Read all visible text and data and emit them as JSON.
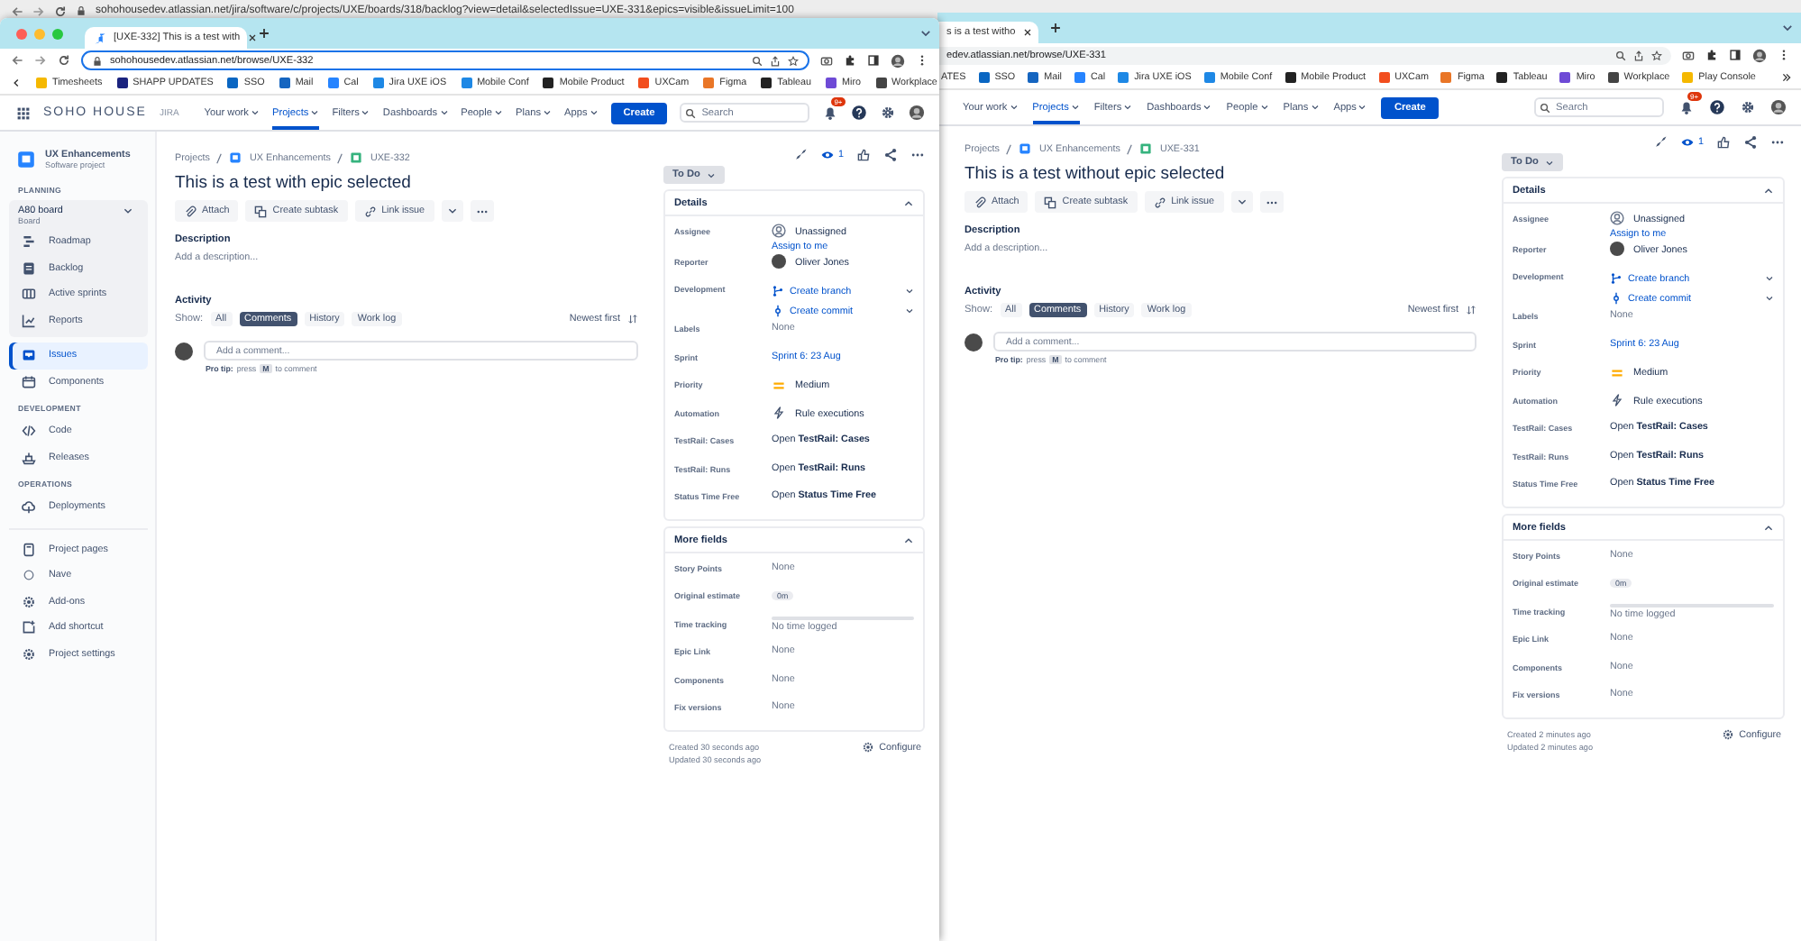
{
  "background_window": {
    "url": "sohohousedev.atlassian.net/jira/software/c/projects/UXE/boards/318/backlog?view=detail&selectedIssue=UXE-331&epics=visible&issueLimit=100"
  },
  "windows": [
    {
      "tab_title": "[UXE-332] This is a test with",
      "url": "sohohousedev.atlassian.net/browse/UXE-332",
      "bookmarks": [
        "Timesheets",
        "SHAPP UPDATES",
        "SSO",
        "Mail",
        "Cal",
        "Jira UXE iOS",
        "Mobile Conf",
        "Mobile Product",
        "UXCam",
        "Figma",
        "Tableau",
        "Miro",
        "Workplace"
      ],
      "nav": {
        "logo": "SOHO HOUSE",
        "product": "JIRA",
        "menu": [
          {
            "label": "Your work",
            "selected": false
          },
          {
            "label": "Projects",
            "selected": true
          },
          {
            "label": "Filters",
            "selected": false
          },
          {
            "label": "Dashboards",
            "selected": false
          },
          {
            "label": "People",
            "selected": false
          },
          {
            "label": "Plans",
            "selected": false
          },
          {
            "label": "Apps",
            "selected": false
          }
        ],
        "create": "Create",
        "search_placeholder": "Search",
        "notifications": "9+"
      },
      "sidebar": {
        "project": {
          "name": "UX Enhancements",
          "type": "Software project"
        },
        "sections": [
          {
            "heading": "PLANNING",
            "board": {
              "name": "A80 board",
              "subtitle": "Board",
              "items": [
                {
                  "label": "Roadmap",
                  "selected": false
                },
                {
                  "label": "Backlog",
                  "selected": false
                },
                {
                  "label": "Active sprints",
                  "selected": false
                },
                {
                  "label": "Reports",
                  "selected": false
                }
              ]
            },
            "items": [
              {
                "label": "Issues",
                "selected": true
              },
              {
                "label": "Components",
                "selected": false
              }
            ]
          },
          {
            "heading": "DEVELOPMENT",
            "items": [
              {
                "label": "Code",
                "selected": false
              },
              {
                "label": "Releases",
                "selected": false
              }
            ]
          },
          {
            "heading": "OPERATIONS",
            "items": [
              {
                "label": "Deployments",
                "selected": false
              }
            ]
          }
        ],
        "footer_items": [
          {
            "label": "Project pages",
            "selected": false
          },
          {
            "label": "Nave",
            "selected": false
          },
          {
            "label": "Add-ons",
            "selected": false
          },
          {
            "label": "Add shortcut",
            "selected": false
          },
          {
            "label": "Project settings",
            "selected": false
          }
        ]
      },
      "issue": {
        "breadcrumbs": [
          "Projects",
          "UX Enhancements",
          "UXE-332"
        ],
        "title": "This is a test with epic selected",
        "actions": [
          "Attach",
          "Create subtask",
          "Link issue"
        ],
        "watchers": "1",
        "description_label": "Description",
        "description_placeholder": "Add a description...",
        "activity_label": "Activity",
        "show_label": "Show:",
        "filters": [
          {
            "label": "All",
            "selected": false
          },
          {
            "label": "Comments",
            "selected": true
          },
          {
            "label": "History",
            "selected": false
          },
          {
            "label": "Work log",
            "selected": false
          }
        ],
        "sort": "Newest first",
        "comment_placeholder": "Add a comment...",
        "pro_tip": {
          "label": "Pro tip:",
          "before": "press",
          "key": "M",
          "after": "to comment"
        },
        "status": "To Do",
        "details_title": "Details",
        "details": [
          {
            "label": "Assignee",
            "kind": "assignee",
            "value": "Unassigned",
            "action": "Assign to me"
          },
          {
            "label": "Reporter",
            "kind": "user",
            "value": "Oliver Jones"
          },
          {
            "label": "Development",
            "kind": "development",
            "links": [
              "Create branch",
              "Create commit"
            ]
          },
          {
            "label": "Labels",
            "kind": "text",
            "value": "None"
          },
          {
            "label": "Sprint",
            "kind": "link",
            "value": "Sprint 6: 23 Aug"
          },
          {
            "label": "Priority",
            "kind": "priority",
            "value": "Medium"
          },
          {
            "label": "Automation",
            "kind": "automation",
            "value": "Rule executions"
          },
          {
            "label": "TestRail: Cases",
            "kind": "open",
            "value": "Open **TestRail: Cases**"
          },
          {
            "label": "TestRail: Runs",
            "kind": "open",
            "value": "Open **TestRail: Runs**"
          },
          {
            "label": "Status Time Free",
            "kind": "open",
            "value": "Open **Status Time Free**"
          }
        ],
        "more_title": "More fields",
        "more_fields": [
          {
            "label": "Story Points",
            "kind": "text",
            "value": "None"
          },
          {
            "label": "Original estimate",
            "kind": "badge",
            "value": "0m"
          },
          {
            "label": "Time tracking",
            "kind": "tracking",
            "value": "No time logged",
            "level": 0
          },
          {
            "label": "Epic Link",
            "kind": "text",
            "value": "None"
          },
          {
            "label": "Components",
            "kind": "text",
            "value": "None"
          },
          {
            "label": "Fix versions",
            "kind": "text",
            "value": "None"
          }
        ],
        "created": "Created 30 seconds ago",
        "updated": "Updated 30 seconds ago",
        "configure": "Configure"
      }
    },
    {
      "tab_title": "s is a test witho",
      "url": "edev.atlassian.net/browse/UXE-331",
      "bookmarks": [
        "ATES",
        "SSO",
        "Mail",
        "Cal",
        "Jira UXE iOS",
        "Mobile Conf",
        "Mobile Product",
        "UXCam",
        "Figma",
        "Tableau",
        "Miro",
        "Workplace",
        "Play Console"
      ],
      "nav": {
        "menu": [
          {
            "label": "Your work",
            "selected": false
          },
          {
            "label": "Projects",
            "selected": true
          },
          {
            "label": "Filters",
            "selected": false
          },
          {
            "label": "Dashboards",
            "selected": false
          },
          {
            "label": "People",
            "selected": false
          },
          {
            "label": "Plans",
            "selected": false
          },
          {
            "label": "Apps",
            "selected": false
          }
        ],
        "create": "Create",
        "search_placeholder": "Search",
        "notifications": "9+"
      },
      "issue": {
        "breadcrumbs": [
          "Projects",
          "UX Enhancements",
          "UXE-331"
        ],
        "title": "This is a test without epic selected",
        "actions": [
          "Attach",
          "Create subtask",
          "Link issue"
        ],
        "watchers": "1",
        "description_label": "Description",
        "description_placeholder": "Add a description...",
        "activity_label": "Activity",
        "show_label": "Show:",
        "filters": [
          {
            "label": "All",
            "selected": false
          },
          {
            "label": "Comments",
            "selected": true
          },
          {
            "label": "History",
            "selected": false
          },
          {
            "label": "Work log",
            "selected": false
          }
        ],
        "sort": "Newest first",
        "comment_placeholder": "Add a comment...",
        "pro_tip": {
          "label": "Pro tip:",
          "before": "press",
          "key": "M",
          "after": "to comment"
        },
        "status": "To Do",
        "details_title": "Details",
        "details": [
          {
            "label": "Assignee",
            "kind": "assignee",
            "value": "Unassigned",
            "action": "Assign to me"
          },
          {
            "label": "Reporter",
            "kind": "user",
            "value": "Oliver Jones"
          },
          {
            "label": "Development",
            "kind": "development",
            "links": [
              "Create branch",
              "Create commit"
            ]
          },
          {
            "label": "Labels",
            "kind": "text",
            "value": "None"
          },
          {
            "label": "Sprint",
            "kind": "link",
            "value": "Sprint 6: 23 Aug"
          },
          {
            "label": "Priority",
            "kind": "priority",
            "value": "Medium"
          },
          {
            "label": "Automation",
            "kind": "automation",
            "value": "Rule executions"
          },
          {
            "label": "TestRail: Cases",
            "kind": "open",
            "value": "Open **TestRail: Cases**"
          },
          {
            "label": "TestRail: Runs",
            "kind": "open",
            "value": "Open **TestRail: Runs**"
          },
          {
            "label": "Status Time Free",
            "kind": "open",
            "value": "Open **Status Time Free**"
          }
        ],
        "more_title": "More fields",
        "more_fields": [
          {
            "label": "Story Points",
            "kind": "text",
            "value": "None"
          },
          {
            "label": "Original estimate",
            "kind": "badge",
            "value": "0m"
          },
          {
            "label": "Time tracking",
            "kind": "tracking",
            "value": "No time logged",
            "level": 0
          },
          {
            "label": "Epic Link",
            "kind": "text",
            "value": "None"
          },
          {
            "label": "Components",
            "kind": "text",
            "value": "None"
          },
          {
            "label": "Fix versions",
            "kind": "text",
            "value": "None"
          }
        ],
        "created": "Created 2 minutes ago",
        "updated": "Updated 2 minutes ago",
        "configure": "Configure"
      }
    }
  ]
}
